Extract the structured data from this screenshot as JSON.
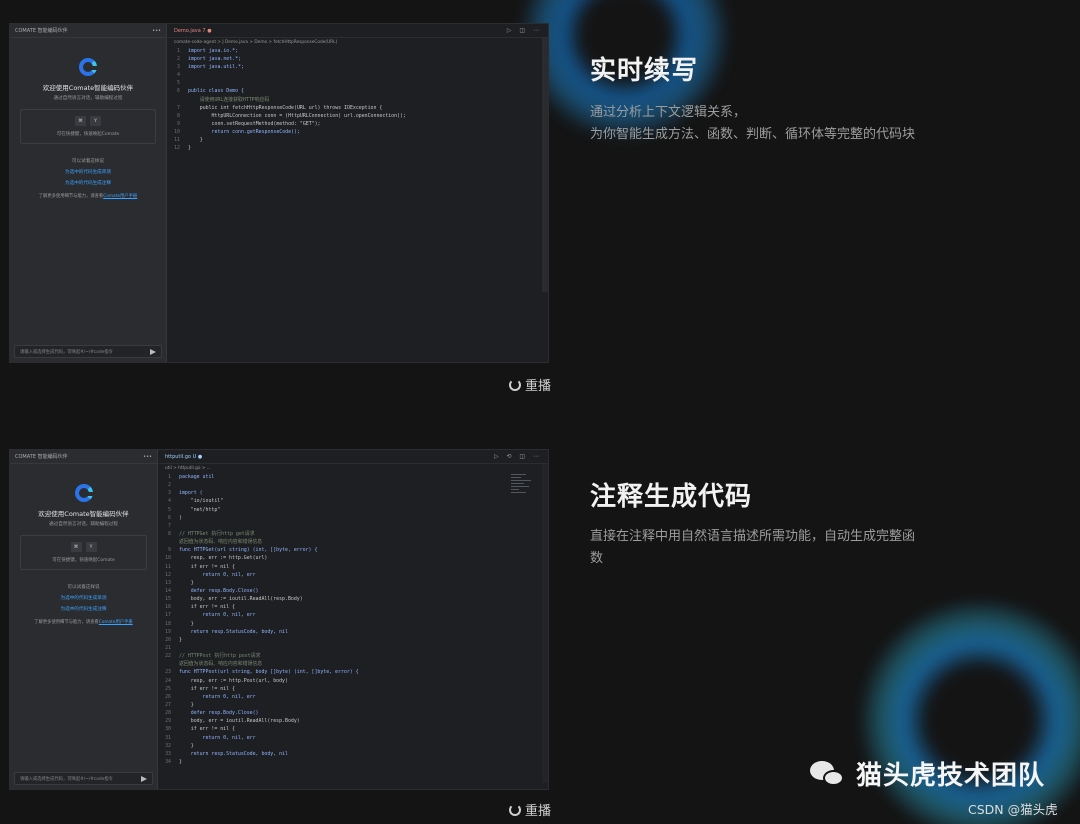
{
  "sections": [
    {
      "title": "实时续写",
      "desc_lines": [
        "通过分析上下文逻辑关系，",
        "为你智能生成方法、函数、判断、循环体等完整的代码块"
      ],
      "replay": "重播"
    },
    {
      "title": "注释生成代码",
      "desc_lines": [
        "直接在注释中用自然语言描述所需功能，自动生成完整函",
        "数"
      ],
      "replay": "重播"
    }
  ],
  "ide1": {
    "side_title": "COMATE 智能编码伙伴",
    "welcome": "欢迎使用Comate智能编码伙伴",
    "sub": "通过自然语言对话，辅助编程过程",
    "keys": [
      "⌘",
      "Y"
    ],
    "key_tip": "可在快捷键，快速唤起Comate",
    "try": "可以试着这样说",
    "links": [
      "为选中的代码生成单测",
      "为选中的代码生成注释"
    ],
    "foot": "了解更多使用细节与能力，请查看",
    "foot_link": "Comate用户手册",
    "chat_placeholder": "请输入或选择生成代码，可唤起#/~/#code指令",
    "tab": "Demo.java 7 ●",
    "breadcrumb": "comate-code-agent > J Demo.java > Demo > fetchHttpResponseCode(URL)",
    "code": [
      {
        "n": "1",
        "t": "import java.io.*;"
      },
      {
        "n": "2",
        "t": "import java.net.*;"
      },
      {
        "n": "3",
        "t": "import java.util.*;"
      },
      {
        "n": "4",
        "t": ""
      },
      {
        "n": "5",
        "t": ""
      },
      {
        "n": "6",
        "t": "public class Demo {"
      },
      {
        "n": "",
        "t": "    请使用URL连接获取HTTP响应码"
      },
      {
        "n": "7",
        "t": "    public int fetchHttpResponseCode(URL url) throws IOException {"
      },
      {
        "n": "8",
        "t": "        HttpURLConnection conn = (HttpURLConnection) url.openConnection();"
      },
      {
        "n": "9",
        "t": "        conn.setRequestMethod(method: \"GET\");"
      },
      {
        "n": "10",
        "t": "        return conn.getResponseCode();"
      },
      {
        "n": "11",
        "t": "    }"
      },
      {
        "n": "12",
        "t": "}"
      }
    ]
  },
  "ide2": {
    "side_title": "COMATE 智能编码伙伴",
    "welcome": "欢迎使用Comate智能编码伙伴",
    "sub": "通过自然语言对话，辅助编程过程",
    "keys": [
      "⌘",
      "Y"
    ],
    "key_tip": "可在快捷键，快速唤起Comate",
    "try": "可以试着这样说",
    "links": [
      "为选中的代码生成单测",
      "为选中的代码生成注释"
    ],
    "foot": "了解更多使用细节与能力，请查看",
    "foot_link": "Comate用户手册",
    "chat_placeholder": "请输入或选择生成代码，可唤起#/~/#code指令",
    "tab": "httputil.go U ●",
    "breadcrumb": "util > httputil.go > ...",
    "code": [
      {
        "n": "1",
        "t": "package util"
      },
      {
        "n": "2",
        "t": ""
      },
      {
        "n": "3",
        "t": "import ("
      },
      {
        "n": "4",
        "t": "    \"io/ioutil\""
      },
      {
        "n": "5",
        "t": "    \"net/http\""
      },
      {
        "n": "6",
        "t": ")"
      },
      {
        "n": "7",
        "t": ""
      },
      {
        "n": "8",
        "t": "// HTTPGet 执行http get请求"
      },
      {
        "n": "",
        "t": "返回值为状态码、响应内容和错误信息"
      },
      {
        "n": "9",
        "t": "func HTTPGet(url string) (int, []byte, error) {"
      },
      {
        "n": "10",
        "t": "    resp, err := http.Get(url)"
      },
      {
        "n": "11",
        "t": "    if err != nil {"
      },
      {
        "n": "12",
        "t": "        return 0, nil, err"
      },
      {
        "n": "13",
        "t": "    }"
      },
      {
        "n": "14",
        "t": "    defer resp.Body.Close()"
      },
      {
        "n": "15",
        "t": "    body, err := ioutil.ReadAll(resp.Body)"
      },
      {
        "n": "16",
        "t": "    if err != nil {"
      },
      {
        "n": "17",
        "t": "        return 0, nil, err"
      },
      {
        "n": "18",
        "t": "    }"
      },
      {
        "n": "19",
        "t": "    return resp.StatusCode, body, nil"
      },
      {
        "n": "20",
        "t": "}"
      },
      {
        "n": "21",
        "t": ""
      },
      {
        "n": "22",
        "t": "// HTTPPost 执行http post请求"
      },
      {
        "n": "",
        "t": "返回值为状态码、响应内容和错误信息"
      },
      {
        "n": "23",
        "t": "func HTTPPost(url string, body []byte) (int, []byte, error) {"
      },
      {
        "n": "24",
        "t": "    resp, err := http.Post(url, body)"
      },
      {
        "n": "25",
        "t": "    if err != nil {"
      },
      {
        "n": "26",
        "t": "        return 0, nil, err"
      },
      {
        "n": "27",
        "t": "    }"
      },
      {
        "n": "28",
        "t": "    defer resp.Body.Close()"
      },
      {
        "n": "29",
        "t": "    body, err = ioutil.ReadAll(resp.Body)"
      },
      {
        "n": "30",
        "t": "    if err != nil {"
      },
      {
        "n": "31",
        "t": "        return 0, nil, err"
      },
      {
        "n": "32",
        "t": "    }"
      },
      {
        "n": "33",
        "t": "    return resp.StatusCode, body, nil"
      },
      {
        "n": "34",
        "t": "}"
      }
    ]
  },
  "watermark": {
    "name": "猫头虎技术团队",
    "csdn": "CSDN @猫头虎"
  }
}
